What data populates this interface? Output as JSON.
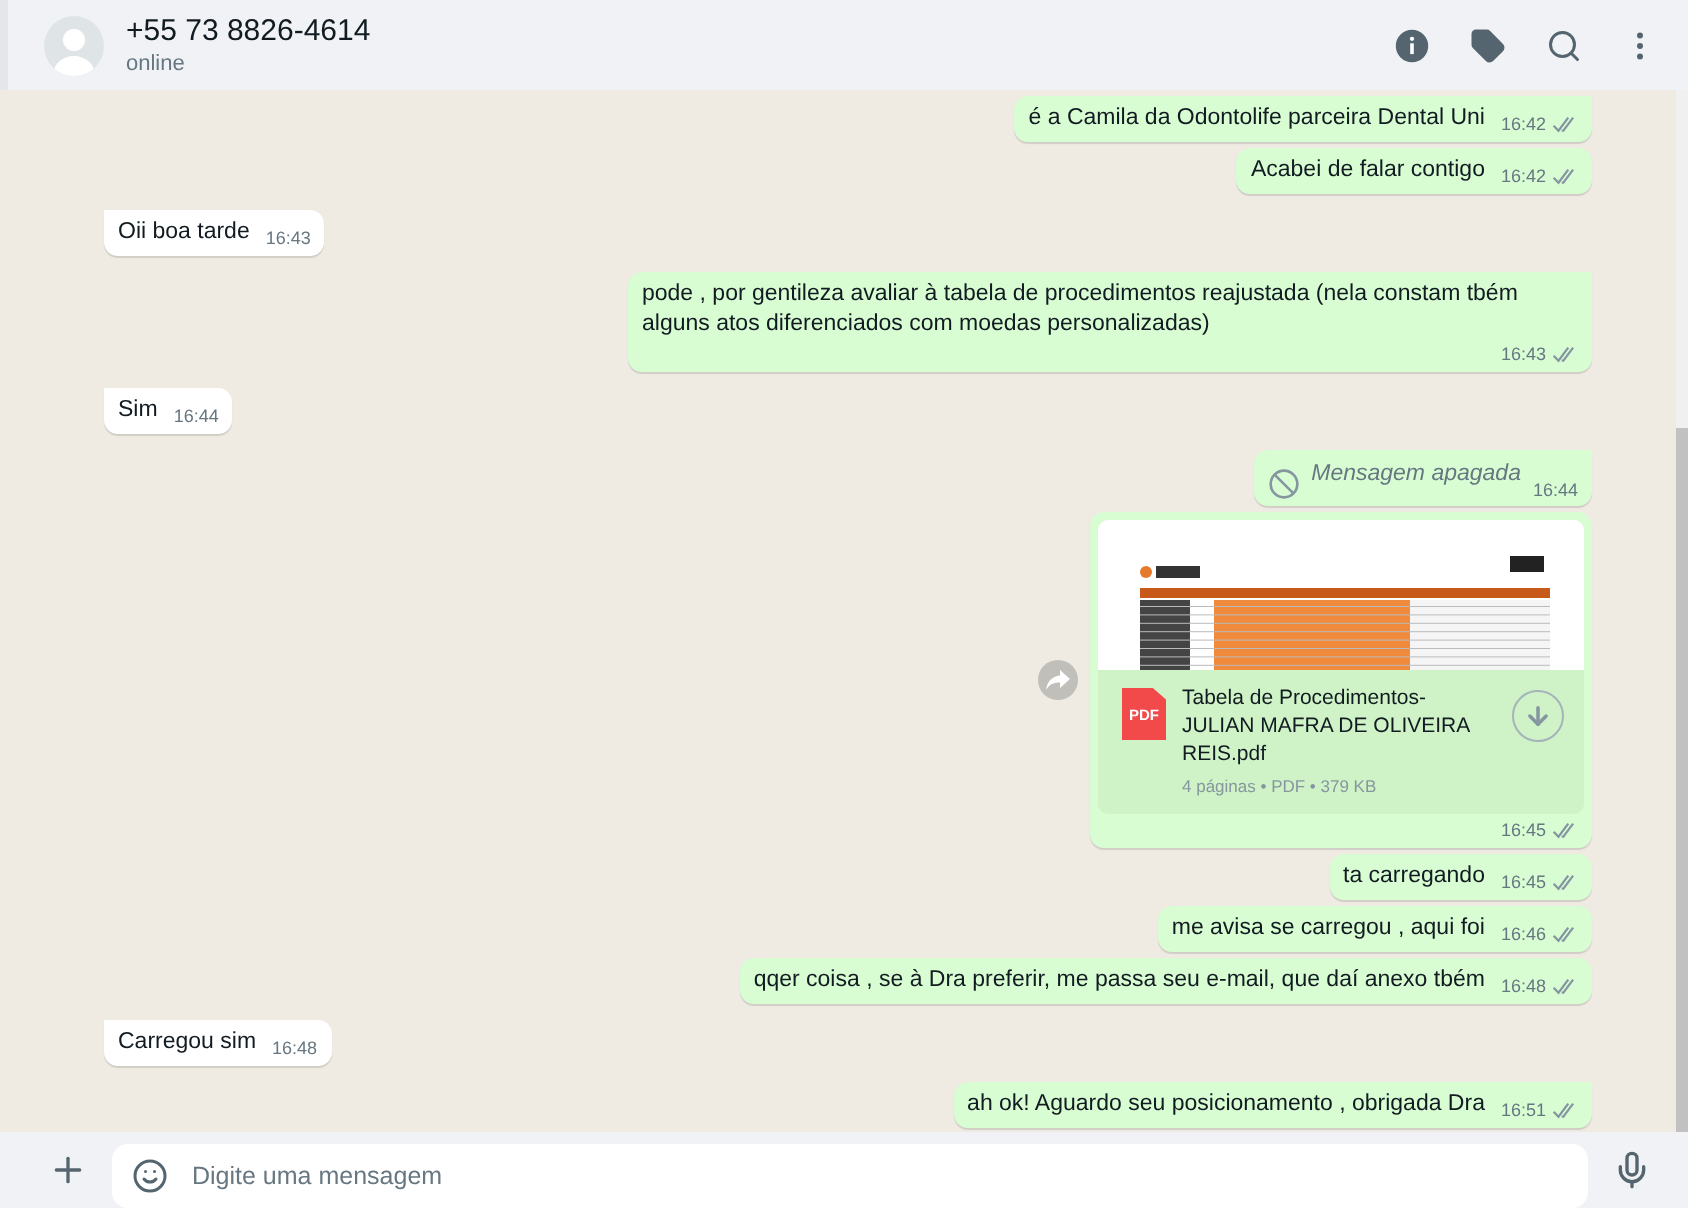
{
  "header": {
    "contact_name": "+55 73 8826-4614",
    "status": "online"
  },
  "messages": [
    {
      "outgoing": true,
      "kind": "text",
      "text": "é a Camila da Odontolife parceira Dental Uni",
      "time": "16:42"
    },
    {
      "outgoing": true,
      "kind": "text",
      "text": "Acabei de falar contigo",
      "time": "16:42"
    },
    {
      "outgoing": false,
      "kind": "text",
      "text": "Oii boa tarde",
      "time": "16:43"
    },
    {
      "outgoing": true,
      "kind": "text",
      "text": "pode , por gentileza avaliar à tabela de procedimentos reajustada (nela constam tbém alguns atos diferenciados com moedas personalizadas)",
      "time": "16:43"
    },
    {
      "outgoing": false,
      "kind": "text",
      "text": "Sim",
      "time": "16:44"
    },
    {
      "outgoing": true,
      "kind": "deleted",
      "text": "Mensagem apagada",
      "time": "16:44"
    },
    {
      "outgoing": true,
      "kind": "document",
      "file_badge": "PDF",
      "file_name": "Tabela de Procedimentos-JULIAN MAFRA DE OLIVEIRA REIS.pdf",
      "details": "4 páginas • PDF • 379 KB",
      "time": "16:45"
    },
    {
      "outgoing": true,
      "kind": "text",
      "text": "ta carregando",
      "time": "16:45"
    },
    {
      "outgoing": true,
      "kind": "text",
      "text": "me avisa se carregou , aqui foi",
      "time": "16:46"
    },
    {
      "outgoing": true,
      "kind": "text",
      "text": "qqer coisa , se à Dra preferir, me passa seu e-mail, que daí anexo tbém",
      "time": "16:48"
    },
    {
      "outgoing": false,
      "kind": "text",
      "text": "Carregou sim",
      "time": "16:48"
    },
    {
      "outgoing": true,
      "kind": "text",
      "text": "ah ok! Aguardo seu posicionamento , obrigada Dra",
      "time": "16:51"
    }
  ],
  "composer": {
    "placeholder": "Digite uma mensagem"
  }
}
